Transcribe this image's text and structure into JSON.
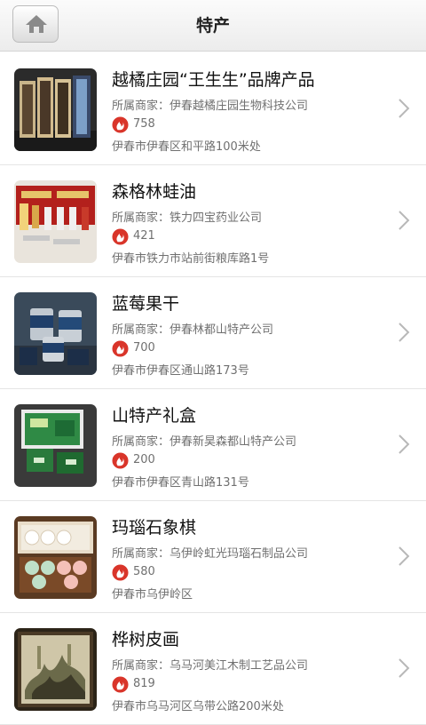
{
  "header": {
    "title": "特产",
    "home_icon": "home-icon"
  },
  "colors": {
    "fire_icon": "#d9352a",
    "secondary_text": "#707070",
    "chevron": "#b8b8b8"
  },
  "items": [
    {
      "name": "越橘庄园“王生生”品牌产品",
      "merchant": "所属商家：伊春越橘庄园生物科技公司",
      "views": "758",
      "address": "伊春市伊春区和平路100米处"
    },
    {
      "name": "森格林蛙油",
      "merchant": "所属商家：铁力四宝药业公司",
      "views": "421",
      "address": "伊春市铁力市站前街粮库路1号"
    },
    {
      "name": "蓝莓果干",
      "merchant": "所属商家：伊春林都山特产公司",
      "views": "700",
      "address": "伊春市伊春区通山路173号"
    },
    {
      "name": "山特产礼盒",
      "merchant": "所属商家：伊春新昊森都山特产公司",
      "views": "200",
      "address": "伊春市伊春区青山路131号"
    },
    {
      "name": "玛瑙石象棋",
      "merchant": "所属商家：乌伊岭虹光玛瑙石制品公司",
      "views": "580",
      "address": "伊春市乌伊岭区"
    },
    {
      "name": "桦树皮画",
      "merchant": "所属商家：乌马河美江木制工艺品公司",
      "views": "819",
      "address": "伊春市乌马河区乌带公路200米处"
    }
  ]
}
